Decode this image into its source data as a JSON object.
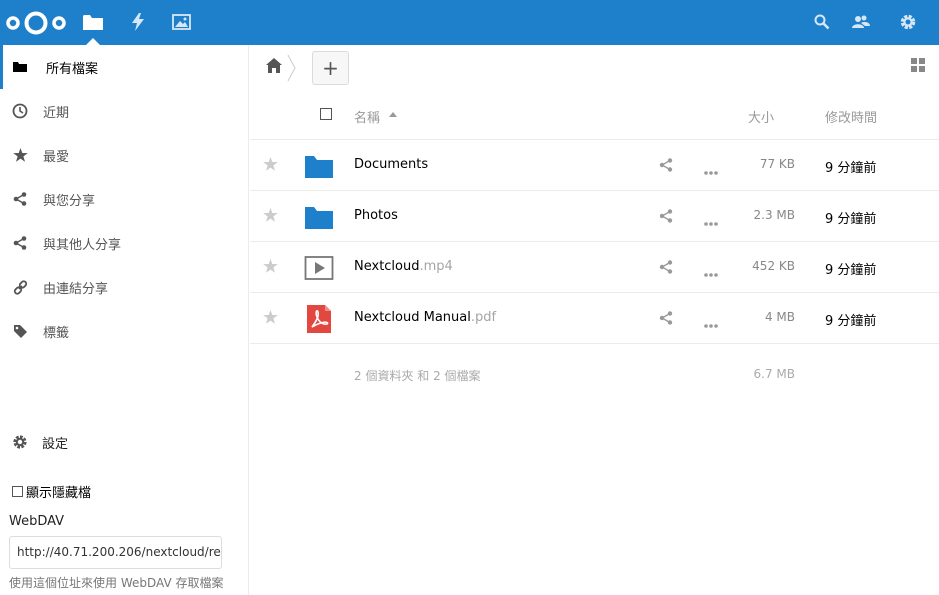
{
  "header": {
    "logo": "nextcloud-logo",
    "apps": [
      "files-icon",
      "activity-icon",
      "gallery-icon"
    ],
    "right_icons": [
      "search-icon",
      "contacts-icon",
      "settings-gear-icon"
    ],
    "brand_color": "#1e7fcb"
  },
  "sidebar": {
    "items": [
      {
        "label": "所有檔案",
        "icon": "folder-icon",
        "active": true
      },
      {
        "label": "近期",
        "icon": "clock-icon"
      },
      {
        "label": "最愛",
        "icon": "star-icon"
      },
      {
        "label": "與您分享",
        "icon": "share-icon"
      },
      {
        "label": "與其他人分享",
        "icon": "share-icon"
      },
      {
        "label": "由連結分享",
        "icon": "link-icon"
      },
      {
        "label": "標籤",
        "icon": "tag-icon"
      }
    ],
    "settings_label": "設定",
    "show_hidden_label": "顯示隱藏檔",
    "webdav_title": "WebDAV",
    "webdav_url": "http://40.71.200.206/nextcloud/re",
    "webdav_hint": "使用這個位址來使用 WebDAV 存取檔案"
  },
  "toolbar": {
    "new_label": "+"
  },
  "table": {
    "col_name": "名稱",
    "col_size": "大小",
    "col_modified": "修改時間",
    "rows": [
      {
        "name": "Documents",
        "ext": "",
        "type": "folder",
        "size": "77 KB",
        "modified": "9 分鐘前"
      },
      {
        "name": "Photos",
        "ext": "",
        "type": "folder",
        "size": "2.3 MB",
        "modified": "9 分鐘前"
      },
      {
        "name": "Nextcloud",
        "ext": ".mp4",
        "type": "video",
        "size": "452 KB",
        "modified": "9 分鐘前"
      },
      {
        "name": "Nextcloud Manual",
        "ext": ".pdf",
        "type": "pdf",
        "size": "4 MB",
        "modified": "9 分鐘前"
      }
    ],
    "summary": "2 個資料夾 和 2 個檔案",
    "summary_size": "6.7 MB"
  }
}
